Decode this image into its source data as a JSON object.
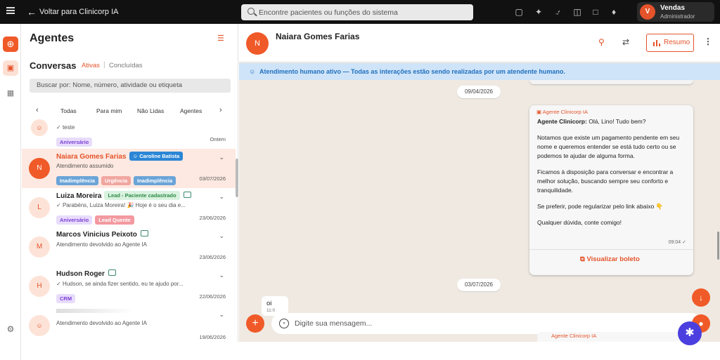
{
  "topbar": {
    "back_label": "Voltar para Clinicorp IA",
    "search_placeholder": "Encontre pacientes ou funções do sistema",
    "icons": [
      "video-icon",
      "sparkle-icon",
      "headset-icon",
      "gift-icon",
      "chat-icon",
      "bell-icon"
    ],
    "user": {
      "initial": "V",
      "name": "Vendas",
      "role": "Administrador"
    }
  },
  "panel": {
    "title": "Agentes",
    "conversations_label": "Conversas",
    "tab_active": "Ativas",
    "tab_done": "Concluídas",
    "search_placeholder": "Buscar por: Nome, número, atividade ou etiqueta",
    "filters": [
      "Todas",
      "Para mim",
      "Não Lidas",
      "Agentes"
    ]
  },
  "conversations": [
    {
      "initial": "",
      "name": "",
      "message": "teste",
      "tags": [
        "Aniversário"
      ],
      "date": "Ontem",
      "selected": false
    },
    {
      "initial": "N",
      "name": "Naiara Gomes Farias",
      "assignee": "Caroline Batista",
      "message": "Atendimento assumido",
      "tags": [
        "Inadimplência",
        "Urgência",
        "Inadimplência"
      ],
      "date": "03/07/2026",
      "selected": true
    },
    {
      "initial": "L",
      "name": "Luiza Moreira",
      "label": "Lead - Paciente cadastrado",
      "message": "Parabéns, Luiza Moreira! 🎉 Hoje é o seu dia e...",
      "tags": [
        "Aniversário",
        "Lead Quente"
      ],
      "date": "23/06/2026",
      "selected": false
    },
    {
      "initial": "M",
      "name": "Marcos Vinicius Peixoto",
      "message": "Atendimento devolvido ao Agente IA",
      "tags": [],
      "date": "23/06/2026",
      "selected": false
    },
    {
      "initial": "H",
      "name": "Hudson Roger",
      "message": "Hudson, se ainda fizer sentido, eu te ajudo por...",
      "tags": [
        "CRM"
      ],
      "date": "22/06/2026",
      "selected": false
    },
    {
      "initial": "",
      "name": "",
      "message": "Atendimento devolvido ao Agente IA",
      "tags": [],
      "date": "19/06/2026",
      "selected": false
    }
  ],
  "tag_colors": {
    "Aniversário": {
      "bg": "#e8dcfb",
      "fg": "#7a3fd6"
    },
    "Inadimplência": {
      "bg": "#6aa4d8",
      "fg": "#ffffff"
    },
    "Urgência": {
      "bg": "#f0a6a0",
      "fg": "#ffffff"
    },
    "Lead Quente": {
      "bg": "#f29aa0",
      "fg": "#ffffff"
    },
    "CRM": {
      "bg": "#e8dcfb",
      "fg": "#7a3fd6"
    }
  },
  "chat": {
    "contact_initial": "N",
    "contact_name": "Naiara Gomes Farias",
    "resumo_label": "Resumo",
    "banner": "Atendimento humano ativo — Todas as interações estão sendo realizadas por um atendente humano.",
    "date1": "09/04/2026",
    "date2": "03/07/2026",
    "bubble": {
      "agent_label": "Agente Clinicorp IA",
      "greeting_bold": "Agente Clinicorp:",
      "greeting": " Olá, Lino! Tudo bem?",
      "p1": "Notamos que existe um pagamento pendente em seu nome e queremos entender se está tudo certo ou se podemos te ajudar de alguma forma.",
      "p2": "Ficamos à disposição para conversar e encontrar a melhor solução, buscando sempre seu conforto e tranquilidade.",
      "p3": "Se preferir, pode regularizar pelo link abaixo 👇",
      "p4": "Qualquer dúvida, conte comigo!",
      "time": "09:04",
      "link": "Visualizar boleto"
    },
    "incoming": {
      "text": "oi",
      "time": "11:0"
    },
    "composer_placeholder": "Digite sua mensagem...",
    "tail_label": "Agente Clinicorp IA"
  },
  "colors": {
    "accent": "#f05a28",
    "banner_text": "#1f6fbf",
    "ai_fab": "#4b3fe0"
  }
}
